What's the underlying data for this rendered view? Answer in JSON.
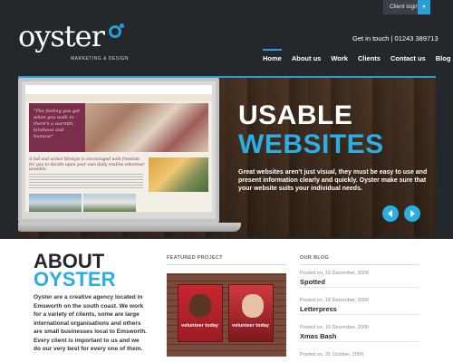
{
  "header": {
    "client_login": "Client login",
    "logo_word": "oyster",
    "logo_tagline": "MARKETING & DESIGN",
    "contact": "Get in touch | 01243 389713"
  },
  "nav": {
    "items": [
      {
        "label": "Home",
        "active": true
      },
      {
        "label": "About us",
        "active": false
      },
      {
        "label": "Work",
        "active": false
      },
      {
        "label": "Clients",
        "active": false
      },
      {
        "label": "Contact us",
        "active": false
      },
      {
        "label": "Blog",
        "active": false
      }
    ]
  },
  "banner": {
    "headline_line1": "USABLE",
    "headline_line2": "WEBSITES",
    "blurb": "Great websites aren't just visual, they must be easy to use and present information clearly and quickly. Oyster make sure that your website suits your individual needs.",
    "screen_quote": "\"The feeling you get when you walk in - there's a warmth, kindness and humour\"",
    "screen_copy": "A full and active lifestyle is encouraged with freedom for you to decide upon your own daily routine wherever possible."
  },
  "about": {
    "title_line1": "ABOUT",
    "title_line2": "OYSTER",
    "text": "Oyster are a creative agency located in Emsworth on the south coast. We work for a variety of clients, some are large international organisations and others are small businesses local to Emsworth. Every client is important to us and we do our very best for every one of them."
  },
  "featured": {
    "label": "FEATURED PROJECT",
    "poster_text_1": "volunteer today",
    "poster_text_2": "volunteer today"
  },
  "blog": {
    "label": "OUR BLOG",
    "posts": [
      {
        "date": "Posted on, 19 December, 2009",
        "title": "Spotted"
      },
      {
        "date": "Posted on, 18 December, 2009",
        "title": "Letterpress"
      },
      {
        "date": "Posted on, 15 December, 2009",
        "title": "Xmas Bash"
      },
      {
        "date": "Posted on, 31 October, 2009",
        "title": ""
      }
    ]
  },
  "colors": {
    "background": "#24282c",
    "accent": "#2aaee4",
    "content_bg": "#ffffff"
  },
  "icons": {
    "client_login_arrow": "chevron-down-icon",
    "slider_prev": "arrow-left-icon",
    "slider_next": "arrow-right-icon"
  }
}
